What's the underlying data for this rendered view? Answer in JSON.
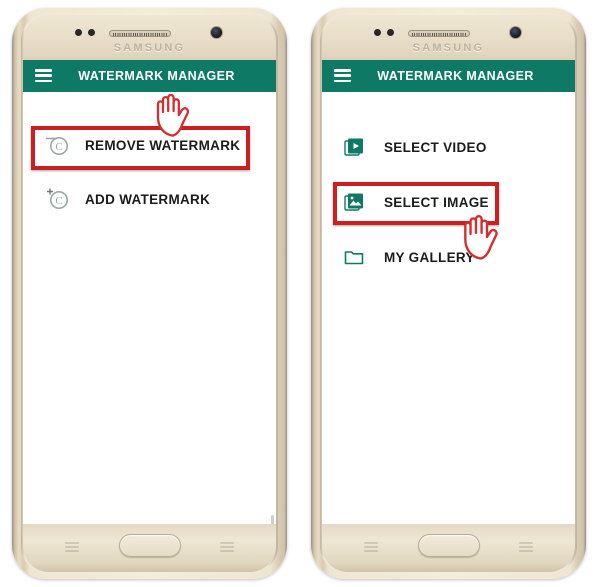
{
  "page": {
    "title": "Watermark Manager app screens",
    "background_color": "#ffffff",
    "accent_color": "#0e7a66",
    "highlight_color": "#cc1f1f"
  },
  "phones": [
    {
      "id": "left",
      "brand": "SAMSUNG",
      "appbar": {
        "menu_icon": "hamburger-icon",
        "title": "WATERMARK MANAGER"
      },
      "menu_items": [
        {
          "label": "REMOVE WATERMARK",
          "icon": "copyright-remove-icon",
          "highlighted": "true"
        },
        {
          "label": "ADD WATERMARK",
          "icon": "copyright-add-icon",
          "highlighted": "false"
        }
      ],
      "cursor": {
        "icon": "pointing-hand-cursor",
        "points_at": "REMOVE WATERMARK"
      }
    },
    {
      "id": "right",
      "brand": "SAMSUNG",
      "appbar": {
        "menu_icon": "hamburger-icon",
        "title": "WATERMARK MANAGER"
      },
      "menu_items": [
        {
          "label": "SELECT VIDEO",
          "icon": "video-stack-icon",
          "highlighted": "false"
        },
        {
          "label": "SELECT IMAGE",
          "icon": "image-stack-icon",
          "highlighted": "true"
        },
        {
          "label": "MY GALLERY",
          "icon": "folder-icon",
          "highlighted": "false"
        }
      ],
      "cursor": {
        "icon": "pointing-hand-cursor",
        "points_at": "SELECT IMAGE"
      }
    }
  ]
}
